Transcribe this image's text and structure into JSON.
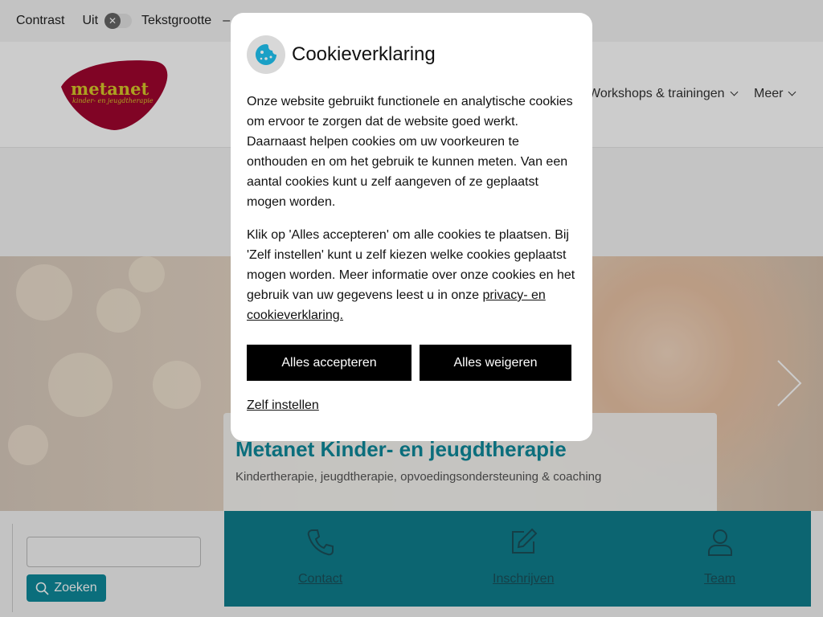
{
  "topbar": {
    "contrast_label": "Contrast",
    "contrast_state": "Uit",
    "textsize_label": "Tekstgrootte",
    "textsize_dash": "–"
  },
  "logo": {
    "text": "metanet",
    "tagline": "kinder- en jeugdtherapie"
  },
  "nav": {
    "items": [
      {
        "label": "Workshops & trainingen"
      },
      {
        "label": "Meer"
      }
    ]
  },
  "hero": {
    "title": "Metanet Kinder- en jeugdtherapie",
    "subtitle": "Kindertherapie, jeugdtherapie, opvoedingsondersteuning & coaching",
    "next_icon": "chevron-right-icon"
  },
  "search": {
    "button_label": "Zoeken",
    "placeholder": "",
    "icon": "search-icon"
  },
  "quicklinks": [
    {
      "label": "Contact",
      "icon": "phone-icon"
    },
    {
      "label": "Inschrijven",
      "icon": "edit-icon"
    },
    {
      "label": "Team",
      "icon": "user-icon"
    }
  ],
  "cookie_dialog": {
    "title": "Cookieverklaring",
    "icon": "cookie-icon",
    "paragraph1": "Onze website gebruikt functionele en analytische cookies om ervoor te zorgen dat de website goed werkt. Daarnaast helpen cookies om uw voorkeuren te onthouden en om het gebruik te kunnen meten. Van een aantal cookies kunt u zelf aangeven of ze geplaatst mogen worden.",
    "paragraph2_text": "Klik op 'Alles accepteren' om alle cookies te plaatsen. Bij 'Zelf instellen' kunt u zelf kiezen welke cookies geplaatst mogen worden. Meer informatie over onze cookies en het gebruik van uw gegevens leest u in onze ",
    "privacy_link": "privacy- en cookieverklaring.",
    "accept_label": "Alles accepteren",
    "reject_label": "Alles weigeren",
    "custom_label": "Zelf instellen"
  },
  "colors": {
    "brand_teal": "#0e8a9c",
    "quicklink_bg": "#0f7f8e",
    "logo_red": "#a0062f",
    "logo_yellow": "#d8c82a",
    "cookie_icon": "#1aa0c6"
  }
}
